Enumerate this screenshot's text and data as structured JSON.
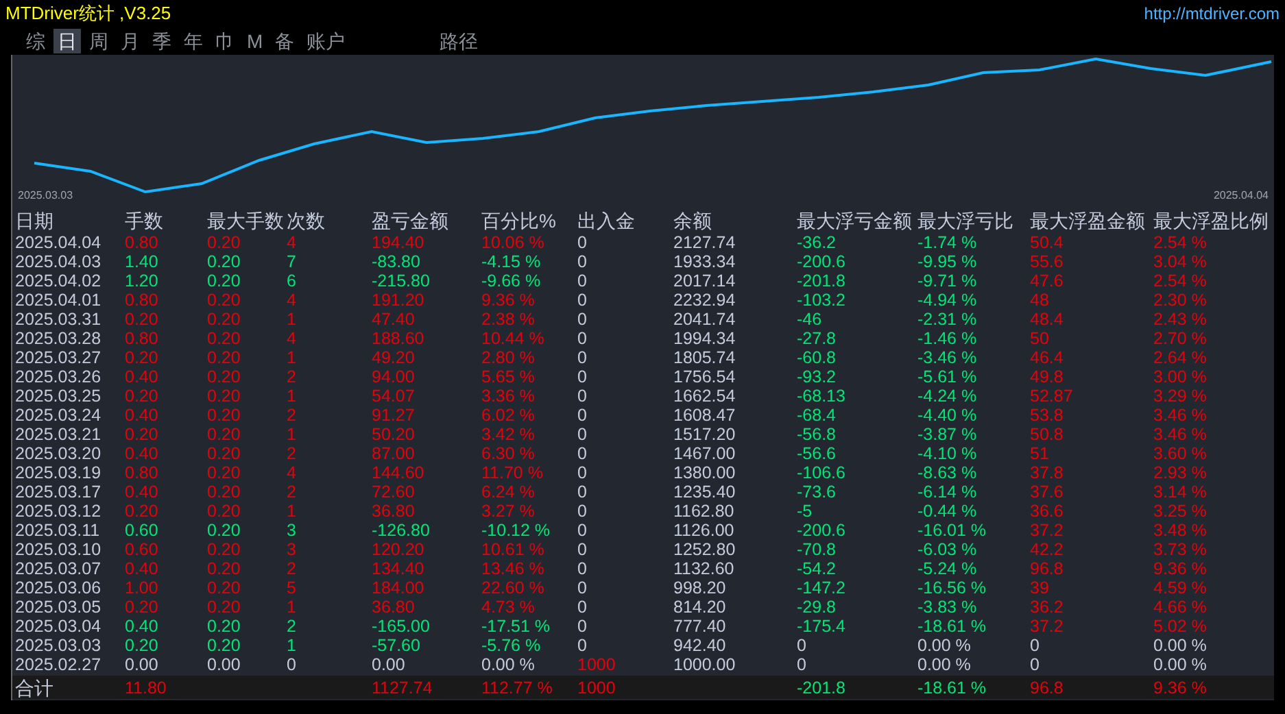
{
  "title": "MTDriver统计 ,V3.25",
  "url": "http://mtdriver.com",
  "tabs": [
    {
      "label": "综",
      "selected": false
    },
    {
      "label": "日",
      "selected": true
    },
    {
      "label": "周",
      "selected": false
    },
    {
      "label": "月",
      "selected": false
    },
    {
      "label": "季",
      "selected": false
    },
    {
      "label": "年",
      "selected": false
    },
    {
      "label": "巾",
      "selected": false
    },
    {
      "label": "M",
      "selected": false
    },
    {
      "label": "备",
      "selected": false
    },
    {
      "label": "账户",
      "selected": false
    },
    {
      "label": "路径",
      "selected": false
    }
  ],
  "chart": {
    "x_start": "2025.03.03",
    "x_end": "2025.04.04"
  },
  "table": {
    "columns": [
      "日期",
      "手数",
      "最大手数",
      "次数",
      "盈亏金额",
      "百分比%",
      "出入金",
      "余额",
      "最大浮亏金额",
      "最大浮亏比",
      "最大浮盈金额",
      "最大浮盈比例"
    ],
    "rows": [
      {
        "cells": [
          "2025.04.04",
          "0.80",
          "0.20",
          "4",
          "194.40",
          "10.06 %",
          "0",
          "2127.74",
          "-36.2",
          "-1.74 %",
          "50.4",
          "2.54 %"
        ],
        "color": "#e8000b",
        "deposit": false,
        "floating": true
      },
      {
        "cells": [
          "2025.04.03",
          "1.40",
          "0.20",
          "7",
          "-83.80",
          "-4.15 %",
          "0",
          "1933.34",
          "-200.6",
          "-9.95 %",
          "55.6",
          "3.04 %"
        ],
        "color": "#00e676",
        "deposit": false,
        "floating": true
      },
      {
        "cells": [
          "2025.04.02",
          "1.20",
          "0.20",
          "6",
          "-215.80",
          "-9.66 %",
          "0",
          "2017.14",
          "-201.8",
          "-9.71 %",
          "47.6",
          "2.54 %"
        ],
        "color": "#00e676",
        "deposit": false,
        "floating": true
      },
      {
        "cells": [
          "2025.04.01",
          "0.80",
          "0.20",
          "4",
          "191.20",
          "9.36 %",
          "0",
          "2232.94",
          "-103.2",
          "-4.94 %",
          "48",
          "2.30 %"
        ],
        "color": "#e8000b",
        "deposit": false,
        "floating": true
      },
      {
        "cells": [
          "2025.03.31",
          "0.20",
          "0.20",
          "1",
          "47.40",
          "2.38 %",
          "0",
          "2041.74",
          "-46",
          "-2.31 %",
          "48.4",
          "2.43 %"
        ],
        "color": "#e8000b",
        "deposit": false,
        "floating": true
      },
      {
        "cells": [
          "2025.03.28",
          "0.80",
          "0.20",
          "4",
          "188.60",
          "10.44 %",
          "0",
          "1994.34",
          "-27.8",
          "-1.46 %",
          "50",
          "2.70 %"
        ],
        "color": "#e8000b",
        "deposit": false,
        "floating": true
      },
      {
        "cells": [
          "2025.03.27",
          "0.20",
          "0.20",
          "1",
          "49.20",
          "2.80 %",
          "0",
          "1805.74",
          "-60.8",
          "-3.46 %",
          "46.4",
          "2.64 %"
        ],
        "color": "#e8000b",
        "deposit": false,
        "floating": true
      },
      {
        "cells": [
          "2025.03.26",
          "0.40",
          "0.20",
          "2",
          "94.00",
          "5.65 %",
          "0",
          "1756.54",
          "-93.2",
          "-5.61 %",
          "49.8",
          "3.00 %"
        ],
        "color": "#e8000b",
        "deposit": false,
        "floating": true
      },
      {
        "cells": [
          "2025.03.25",
          "0.20",
          "0.20",
          "1",
          "54.07",
          "3.36 %",
          "0",
          "1662.54",
          "-68.13",
          "-4.24 %",
          "52.87",
          "3.29 %"
        ],
        "color": "#e8000b",
        "deposit": false,
        "floating": true
      },
      {
        "cells": [
          "2025.03.24",
          "0.40",
          "0.20",
          "2",
          "91.27",
          "6.02 %",
          "0",
          "1608.47",
          "-68.4",
          "-4.40 %",
          "53.8",
          "3.46 %"
        ],
        "color": "#e8000b",
        "deposit": false,
        "floating": true
      },
      {
        "cells": [
          "2025.03.21",
          "0.20",
          "0.20",
          "1",
          "50.20",
          "3.42 %",
          "0",
          "1517.20",
          "-56.8",
          "-3.87 %",
          "50.8",
          "3.46 %"
        ],
        "color": "#e8000b",
        "deposit": false,
        "floating": true
      },
      {
        "cells": [
          "2025.03.20",
          "0.40",
          "0.20",
          "2",
          "87.00",
          "6.30 %",
          "0",
          "1467.00",
          "-56.6",
          "-4.10 %",
          "51",
          "3.60 %"
        ],
        "color": "#e8000b",
        "deposit": false,
        "floating": true
      },
      {
        "cells": [
          "2025.03.19",
          "0.80",
          "0.20",
          "4",
          "144.60",
          "11.70 %",
          "0",
          "1380.00",
          "-106.6",
          "-8.63 %",
          "37.8",
          "2.93 %"
        ],
        "color": "#e8000b",
        "deposit": false,
        "floating": true
      },
      {
        "cells": [
          "2025.03.17",
          "0.40",
          "0.20",
          "2",
          "72.60",
          "6.24 %",
          "0",
          "1235.40",
          "-73.6",
          "-6.14 %",
          "37.6",
          "3.14 %"
        ],
        "color": "#e8000b",
        "deposit": false,
        "floating": true
      },
      {
        "cells": [
          "2025.03.12",
          "0.20",
          "0.20",
          "1",
          "36.80",
          "3.27 %",
          "0",
          "1162.80",
          "-5",
          "-0.44 %",
          "36.6",
          "3.25 %"
        ],
        "color": "#e8000b",
        "deposit": false,
        "floating": true
      },
      {
        "cells": [
          "2025.03.11",
          "0.60",
          "0.20",
          "3",
          "-126.80",
          "-10.12 %",
          "0",
          "1126.00",
          "-200.6",
          "-16.01 %",
          "37.2",
          "3.48 %"
        ],
        "color": "#00e676",
        "deposit": false,
        "floating": true
      },
      {
        "cells": [
          "2025.03.10",
          "0.60",
          "0.20",
          "3",
          "120.20",
          "10.61 %",
          "0",
          "1252.80",
          "-70.8",
          "-6.03 %",
          "42.2",
          "3.73 %"
        ],
        "color": "#e8000b",
        "deposit": false,
        "floating": true
      },
      {
        "cells": [
          "2025.03.07",
          "0.40",
          "0.20",
          "2",
          "134.40",
          "13.46 %",
          "0",
          "1132.60",
          "-54.2",
          "-5.24 %",
          "96.8",
          "9.36 %"
        ],
        "color": "#e8000b",
        "deposit": false,
        "floating": true
      },
      {
        "cells": [
          "2025.03.06",
          "1.00",
          "0.20",
          "5",
          "184.00",
          "22.60 %",
          "0",
          "998.20",
          "-147.2",
          "-16.56 %",
          "39",
          "4.59 %"
        ],
        "color": "#e8000b",
        "deposit": false,
        "floating": true
      },
      {
        "cells": [
          "2025.03.05",
          "0.20",
          "0.20",
          "1",
          "36.80",
          "4.73 %",
          "0",
          "814.20",
          "-29.8",
          "-3.83 %",
          "36.2",
          "4.66 %"
        ],
        "color": "#e8000b",
        "deposit": false,
        "floating": true
      },
      {
        "cells": [
          "2025.03.04",
          "0.40",
          "0.20",
          "2",
          "-165.00",
          "-17.51 %",
          "0",
          "777.40",
          "-175.4",
          "-18.61 %",
          "37.2",
          "5.02 %"
        ],
        "color": "#00e676",
        "deposit": false,
        "floating": true
      },
      {
        "cells": [
          "2025.03.03",
          "0.20",
          "0.20",
          "1",
          "-57.60",
          "-5.76 %",
          "0",
          "942.40",
          "0",
          "0.00 %",
          "0",
          "0.00 %"
        ],
        "color": "#00e676",
        "deposit": false,
        "floating": false
      },
      {
        "cells": [
          "2025.02.27",
          "0.00",
          "0.00",
          "0",
          "0.00",
          "0.00 %",
          "1000",
          "1000.00",
          "0",
          "0.00 %",
          "0",
          "0.00 %"
        ],
        "color": "#c3cbdc",
        "deposit": true,
        "floating": false
      }
    ],
    "totals": {
      "label": "合计",
      "lots": "11.80",
      "pnl": "1127.74",
      "pct": "112.77 %",
      "flow": "1000",
      "float_loss": "-201.8",
      "float_loss_pct": "-18.61 %",
      "float_profit": "96.8",
      "float_profit_pct": "9.36 %"
    }
  }
}
